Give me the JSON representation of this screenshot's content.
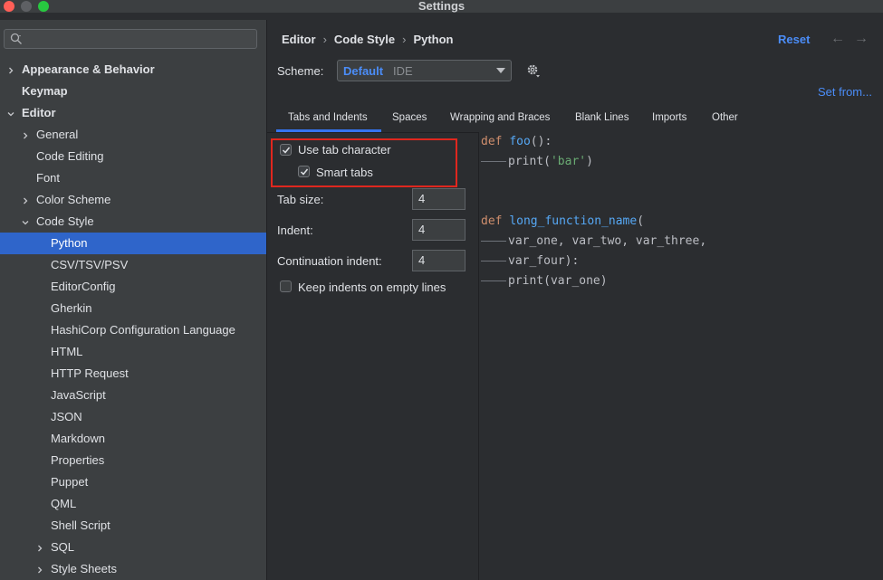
{
  "window": {
    "title": "Settings"
  },
  "sidebar": {
    "search_placeholder": "",
    "items": [
      {
        "label": "Appearance & Behavior",
        "bold": true,
        "chevron": "right",
        "indent": 0
      },
      {
        "label": "Keymap",
        "bold": true,
        "chevron": "",
        "indent": 0
      },
      {
        "label": "Editor",
        "bold": true,
        "chevron": "down",
        "indent": 0
      },
      {
        "label": "General",
        "chevron": "right",
        "indent": 1
      },
      {
        "label": "Code Editing",
        "chevron": "",
        "indent": 1
      },
      {
        "label": "Font",
        "chevron": "",
        "indent": 1
      },
      {
        "label": "Color Scheme",
        "chevron": "right",
        "indent": 1
      },
      {
        "label": "Code Style",
        "chevron": "down",
        "indent": 1
      },
      {
        "label": "Python",
        "chevron": "",
        "indent": 2,
        "selected": true
      },
      {
        "label": "CSV/TSV/PSV",
        "chevron": "",
        "indent": 2
      },
      {
        "label": "EditorConfig",
        "chevron": "",
        "indent": 2
      },
      {
        "label": "Gherkin",
        "chevron": "",
        "indent": 2
      },
      {
        "label": "HashiCorp Configuration Language",
        "chevron": "",
        "indent": 2
      },
      {
        "label": "HTML",
        "chevron": "",
        "indent": 2
      },
      {
        "label": "HTTP Request",
        "chevron": "",
        "indent": 2
      },
      {
        "label": "JavaScript",
        "chevron": "",
        "indent": 2
      },
      {
        "label": "JSON",
        "chevron": "",
        "indent": 2
      },
      {
        "label": "Markdown",
        "chevron": "",
        "indent": 2
      },
      {
        "label": "Properties",
        "chevron": "",
        "indent": 2
      },
      {
        "label": "Puppet",
        "chevron": "",
        "indent": 2
      },
      {
        "label": "QML",
        "chevron": "",
        "indent": 2
      },
      {
        "label": "Shell Script",
        "chevron": "",
        "indent": 2
      },
      {
        "label": "SQL",
        "chevron": "right",
        "indent": 2
      },
      {
        "label": "Style Sheets",
        "chevron": "right",
        "indent": 2
      }
    ]
  },
  "header": {
    "breadcrumb": [
      "Editor",
      "Code Style",
      "Python"
    ],
    "reset_label": "Reset",
    "back_icon": "arrow-left-icon",
    "forward_icon": "arrow-right-icon"
  },
  "scheme": {
    "label": "Scheme:",
    "value": "Default",
    "tag": "IDE",
    "set_from_label": "Set from..."
  },
  "tabs": [
    {
      "label": "Tabs and Indents",
      "active": true
    },
    {
      "label": "Spaces"
    },
    {
      "label": "Wrapping and Braces"
    },
    {
      "label": "Blank Lines"
    },
    {
      "label": "Imports"
    },
    {
      "label": "Other"
    }
  ],
  "form": {
    "use_tab_character": {
      "label": "Use tab character",
      "checked": true
    },
    "smart_tabs": {
      "label": "Smart tabs",
      "checked": true
    },
    "tab_size": {
      "label": "Tab size:",
      "value": "4"
    },
    "indent": {
      "label": "Indent:",
      "value": "4"
    },
    "continuation_indent": {
      "label": "Continuation indent:",
      "value": "4"
    },
    "keep_indents": {
      "label": "Keep indents on empty lines",
      "checked": false
    }
  },
  "code_preview": {
    "line1": {
      "kw": "def",
      "fn": "foo",
      "rest": "():"
    },
    "line2": {
      "pre": "print(",
      "str": "'bar'",
      "post": ")"
    },
    "line3": {
      "kw": "def",
      "fn": "long_function_name",
      "rest": "("
    },
    "line4": {
      "text": "var_one, var_two, var_three,"
    },
    "line5": {
      "text": "var_four):"
    },
    "line6": {
      "text": "print(var_one)"
    }
  },
  "colors": {
    "accent": "#4b8df8",
    "selection": "#2f65ca",
    "highlight_box": "#e0271e"
  }
}
